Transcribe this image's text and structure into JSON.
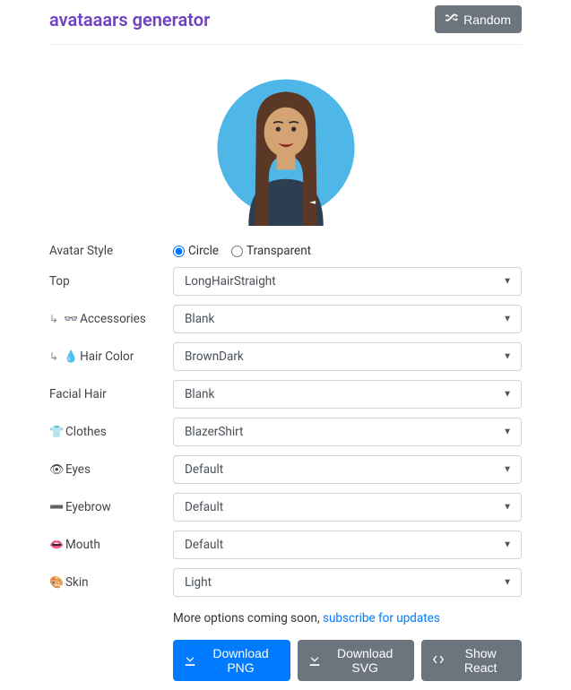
{
  "header": {
    "title": "avataaars generator",
    "random_label": "Random"
  },
  "avatar_style": {
    "label": "Avatar Style",
    "options": {
      "circle": "Circle",
      "transparent": "Transparent"
    },
    "selected": "circle"
  },
  "fields": {
    "top": {
      "label": "Top",
      "value": "LongHairStraight"
    },
    "accessories": {
      "label": "Accessories",
      "value": "Blank"
    },
    "hair_color": {
      "label": "Hair Color",
      "value": "BrownDark"
    },
    "facial_hair": {
      "label": "Facial Hair",
      "value": "Blank"
    },
    "clothes": {
      "label": "Clothes",
      "value": "BlazerShirt"
    },
    "eyes": {
      "label": "Eyes",
      "value": "Default"
    },
    "eyebrow": {
      "label": "Eyebrow",
      "value": "Default"
    },
    "mouth": {
      "label": "Mouth",
      "value": "Default"
    },
    "skin": {
      "label": "Skin",
      "value": "Light"
    }
  },
  "footer": {
    "coming_soon": "More options coming soon, ",
    "subscribe": "subscribe for updates"
  },
  "actions": {
    "download_png": "Download PNG",
    "download_svg": "Download SVG",
    "show_react": "Show React"
  },
  "icons": {
    "tree_branch": "↳",
    "glasses": "👓",
    "droplet": "💧",
    "shirt": "👕",
    "eye": "👁",
    "brow": "➖",
    "mouth": "👄",
    "palette": "🎨"
  }
}
